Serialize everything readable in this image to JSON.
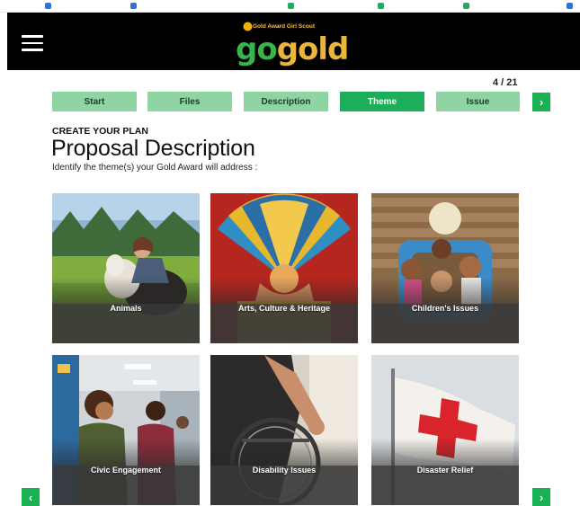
{
  "header": {
    "menu_icon": "hamburger-menu-icon",
    "logo": {
      "tagline": "Gold Award Girl Scout",
      "word_go": "go",
      "word_gold": "gold"
    },
    "background": "#000000"
  },
  "progress": {
    "counter": "4 / 21"
  },
  "steps": [
    {
      "label": "Start",
      "active": false
    },
    {
      "label": "Files",
      "active": false
    },
    {
      "label": "Description",
      "active": false
    },
    {
      "label": "Theme",
      "active": true
    },
    {
      "label": "Issue",
      "active": false
    }
  ],
  "nav": {
    "next_icon": "chevron-right-icon",
    "prev_icon": "chevron-left-icon",
    "next_glyph": "›",
    "prev_glyph": "‹"
  },
  "plan": {
    "eyebrow": "CREATE YOUR PLAN",
    "title": "Proposal Description",
    "instruction": "Identify the theme(s) your Gold Award will address :"
  },
  "themes": [
    {
      "label": "Animals"
    },
    {
      "label": "Arts, Culture & Heritage"
    },
    {
      "label": "Children's Issues"
    },
    {
      "label": "Civic Engagement"
    },
    {
      "label": "Disability Issues"
    },
    {
      "label": "Disaster Relief"
    }
  ],
  "colors": {
    "accent": "#18b153",
    "tab": "#8fd5a3",
    "tab_active": "#1cae5a",
    "go": "#35b54a",
    "gold": "#e9b53a"
  }
}
